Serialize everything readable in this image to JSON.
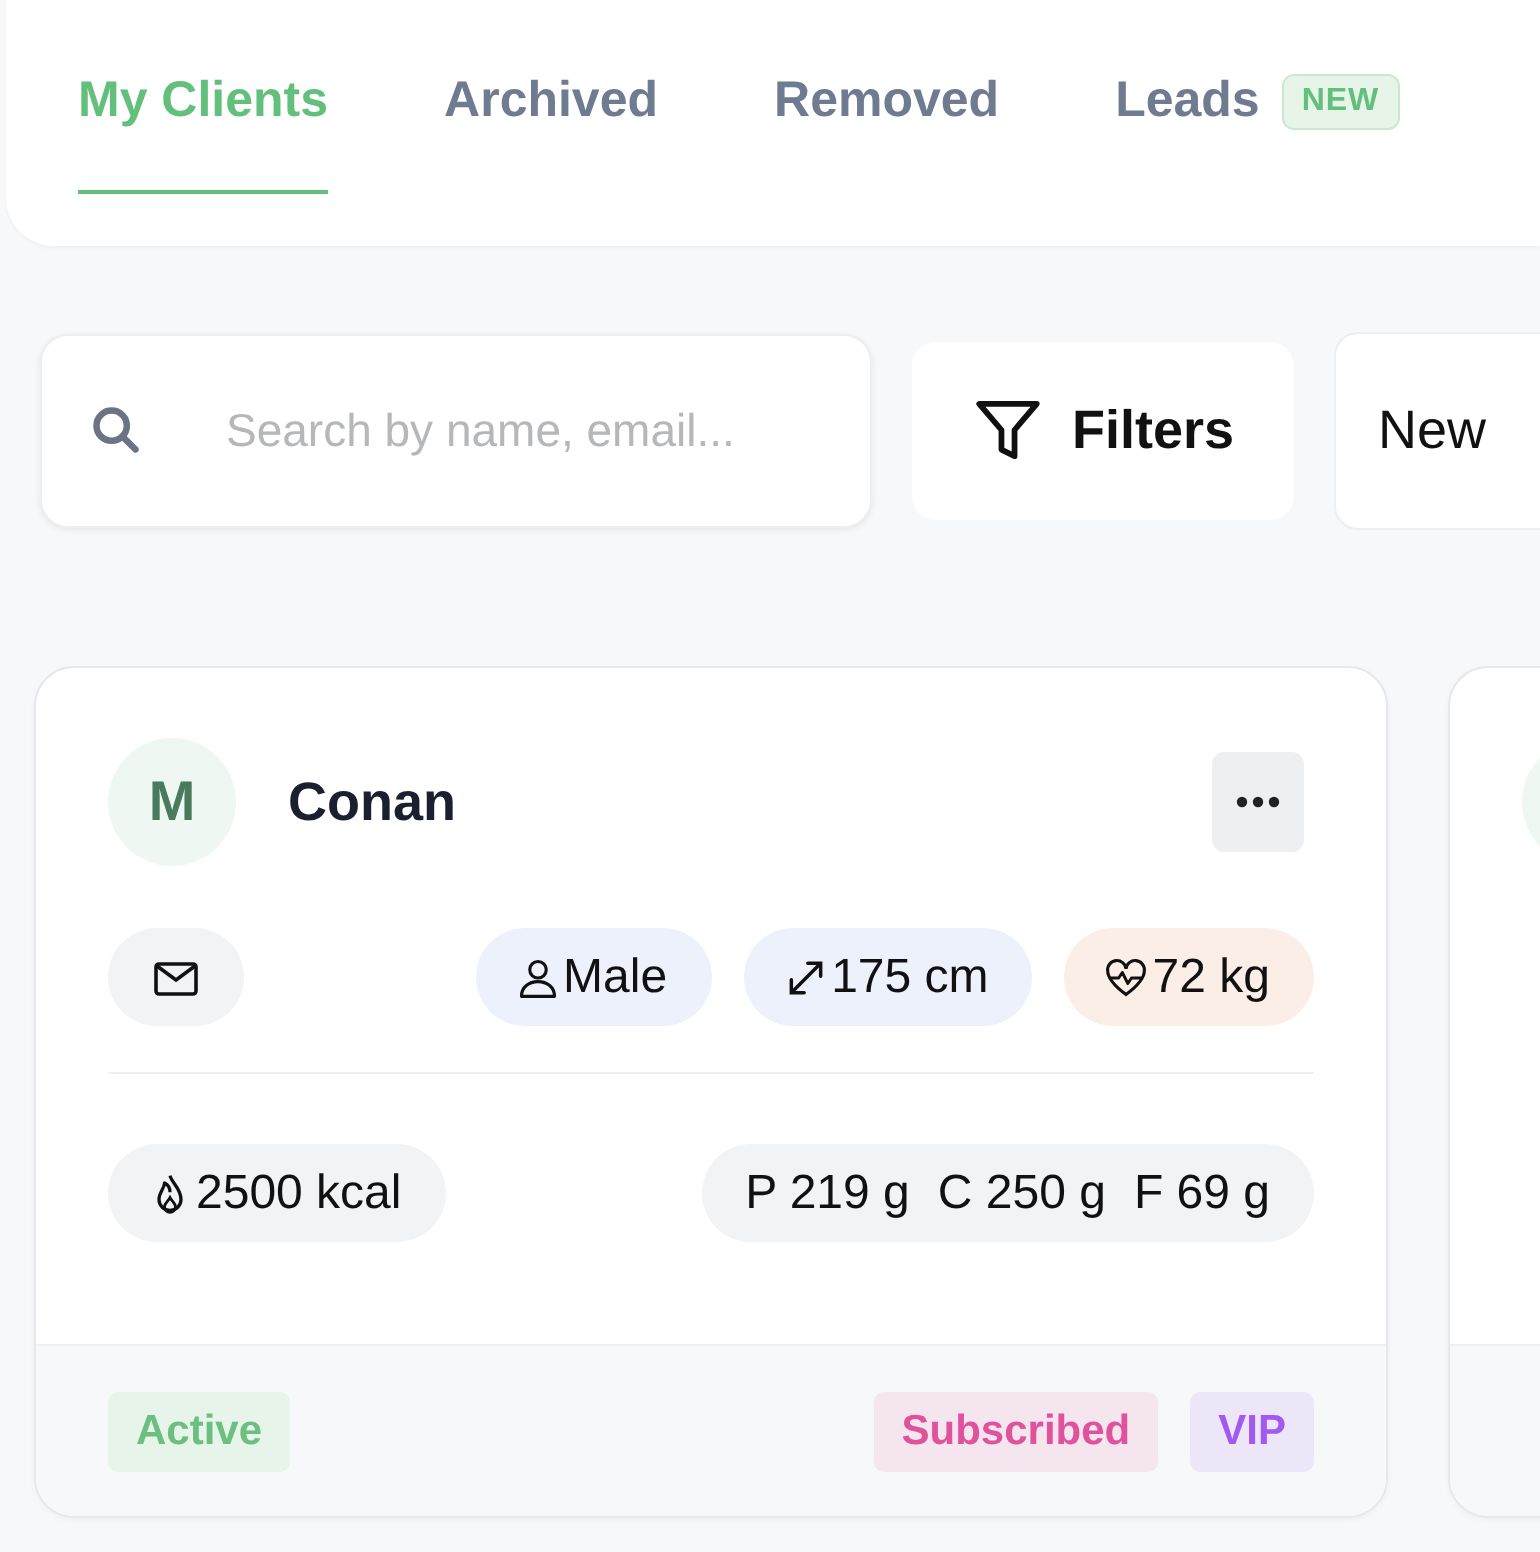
{
  "tabs": [
    {
      "label": "My Clients",
      "selected": true
    },
    {
      "label": "Archived",
      "selected": false
    },
    {
      "label": "Removed",
      "selected": false
    },
    {
      "label": "Leads",
      "selected": false,
      "badge": "NEW"
    }
  ],
  "search": {
    "placeholder": "Search by name, email..."
  },
  "toolbar_buttons": [
    {
      "kind": "filters",
      "label": "Filters"
    },
    {
      "kind": "new",
      "label": "New"
    }
  ],
  "clients": [
    {
      "initial": "M",
      "name": "Conan",
      "stats": [
        {
          "kind": "gender",
          "text": "Male"
        },
        {
          "kind": "height",
          "text": "175 cm"
        },
        {
          "kind": "weight",
          "text": "72 kg"
        }
      ],
      "calories": "2500 kcal",
      "macros": [
        "P 219 g",
        "C 250 g",
        "F 69 g"
      ],
      "status": "Active",
      "tags": [
        {
          "label": "Subscribed",
          "color": "#e0529b"
        },
        {
          "label": "VIP",
          "color": "#a259f0"
        }
      ]
    }
  ]
}
